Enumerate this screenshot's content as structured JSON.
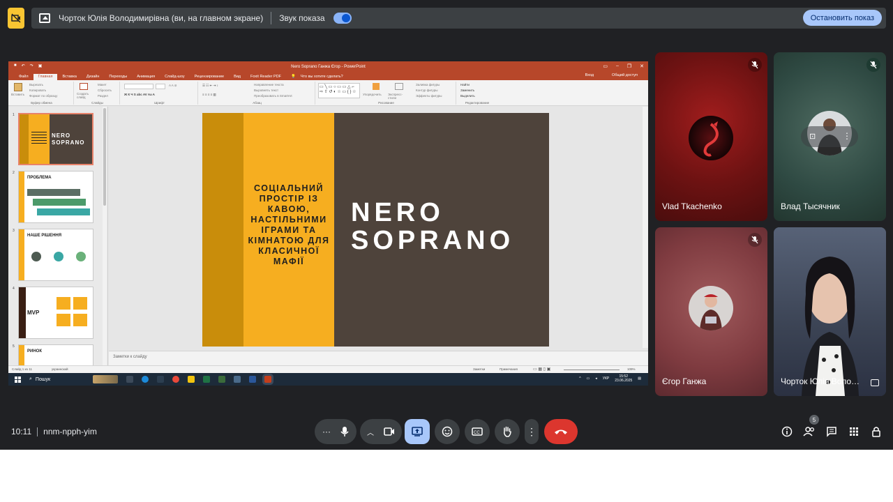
{
  "banner": {
    "presenter_label": "Чорток Юлія Володимирівна (ви, на главном экране)",
    "sound_label": "Звук показа",
    "stop_button": "Остановить показ"
  },
  "ppt": {
    "window_title": "Nero Soprano Ганжа Єгор - PowerPoint",
    "tabs": [
      "Файл",
      "Главная",
      "Вставка",
      "Дизайн",
      "Переходы",
      "Анимация",
      "Слайд-шоу",
      "Рецензирование",
      "Вид",
      "Foxit Reader PDF"
    ],
    "active_tab": "Главная",
    "tell_me": "Что вы хотите сделать?",
    "sign_in": "Вход",
    "share": "Общий доступ",
    "ribbon": {
      "clipboard_group": "Буфер обмена",
      "paste": "Вставить",
      "cut": "Вырезать",
      "copy": "Копировать",
      "format_painter": "Формат по образцу",
      "slides_group": "Слайды",
      "new_slide": "Создать слайд",
      "layout": "Макет",
      "reset": "Сбросить",
      "section": "Раздел",
      "font_group": "Шрифт",
      "paragraph_group": "Абзац",
      "text_direction": "Направление текста",
      "align_text": "Выровнять текст",
      "smartart": "Преобразовать в SmartArt",
      "drawing_group": "Рисование",
      "arrange": "Упорядочить",
      "quick_styles": "Экспресс-стили",
      "shape_fill": "Заливка фигуры",
      "shape_outline": "Контур фигуры",
      "shape_effects": "Эффекты фигуры",
      "editing_group": "Редактирование",
      "find": "Найти",
      "replace": "Заменить",
      "select": "Выделить"
    },
    "thumbnails": [
      {
        "num": "1",
        "title": "NERO SOPRANO"
      },
      {
        "num": "2",
        "title": "ПРОБЛЕМА"
      },
      {
        "num": "3",
        "title": "НАШЕ РІШЕННЯ"
      },
      {
        "num": "4",
        "title": "MVP"
      },
      {
        "num": "5",
        "title": "РИНОК"
      }
    ],
    "slide": {
      "subtitle": "Соціальний простір із кавою, настільними іграми та кімнатою для класичної мафії",
      "title_line1": "NERO",
      "title_line2": "SOPRANO"
    },
    "notes_placeholder": "Заметки к слайду",
    "status": {
      "slide_counter": "Слайд 1 из 11",
      "language": "украинский",
      "notes": "Заметки",
      "comments": "Примечания",
      "zoom": "109%"
    },
    "taskbar": {
      "search": "Пошук",
      "lang": "УКР",
      "time": "15:52",
      "date": "23.06.2025"
    }
  },
  "participants": [
    {
      "name": "Vlad Tkachenko",
      "muted": true
    },
    {
      "name": "Влад Тысячник",
      "muted": true
    },
    {
      "name": "Єгор Ганжа",
      "muted": true
    },
    {
      "name": "Чорток Юлія Воло…",
      "muted": false
    }
  ],
  "bottom": {
    "time": "10:11",
    "meeting_code": "nnm-npph-yim",
    "participant_count": "5"
  },
  "colors": {
    "meet_bg": "#202124",
    "ppt_red": "#b7472a",
    "slide_brown": "#4e433b",
    "slide_yellow": "#f6ae20",
    "hangup_red": "#dc362e",
    "share_blue": "#a8c7fa"
  }
}
